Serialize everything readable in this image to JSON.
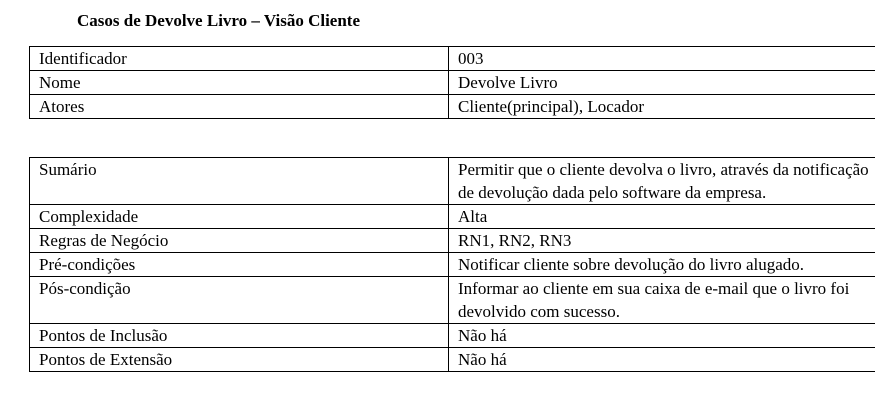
{
  "title": "Casos de Devolve Livro – Visão Cliente",
  "identification": [
    {
      "label": "Identificador",
      "value": "003"
    },
    {
      "label": "Nome",
      "value": "Devolve Livro"
    },
    {
      "label": "Atores",
      "value": "Cliente(principal), Locador"
    }
  ],
  "details": [
    {
      "label": "Sumário",
      "value": "Permitir que o cliente devolva o livro, através da notificação de devolução dada pelo software da empresa."
    },
    {
      "label": "Complexidade",
      "value": "Alta"
    },
    {
      "label": "Regras de Negócio",
      "value": "RN1, RN2, RN3"
    },
    {
      "label": "Pré-condições",
      "value": "Notificar cliente sobre devolução do livro alugado."
    },
    {
      "label": "Pós-condição",
      "value": "Informar ao cliente em sua caixa de e-mail que o livro foi devolvido com sucesso."
    },
    {
      "label": "Pontos de Inclusão",
      "value": "Não há"
    },
    {
      "label": "Pontos de Extensão",
      "value": "Não há"
    }
  ]
}
